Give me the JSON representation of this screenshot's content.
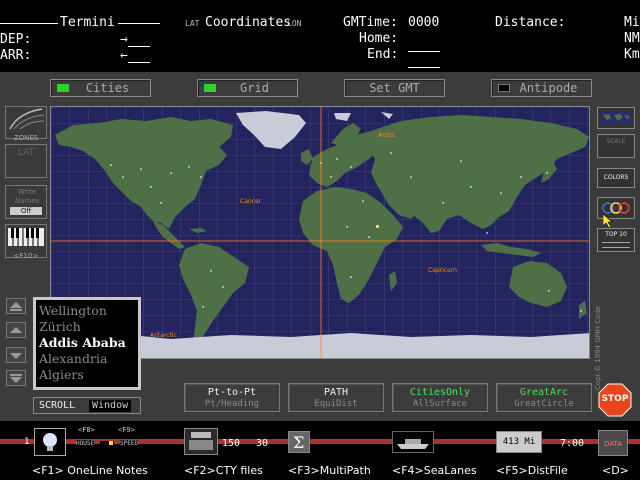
{
  "header": {
    "termini_label": "Termini",
    "dep_label": "DEP:",
    "arr_label": "ARR:",
    "lat_label": "LAT",
    "coordinates_label": "Coordinates",
    "lon_label": "LON",
    "gmtime_label": "GMTime:",
    "gmtime_value": "0000",
    "home_label": "Home:",
    "end_label": "End:",
    "distance_label": "Distance:",
    "unit_mi": "Mi",
    "unit_nm": "NM",
    "unit_km": "Km"
  },
  "toggles": {
    "cities": "Cities",
    "grid": "Grid",
    "set_gmt": "Set GMT",
    "antipode": "Antipode"
  },
  "map": {
    "labels": {
      "arctic": "Arctic",
      "cancer": "Cancer",
      "capricorn": "Capricorn",
      "antarctic": "Antarctic"
    },
    "colors": {
      "ocean": "#23245e",
      "land": "#4f7046",
      "ice": "#c9ccd8",
      "grid": "#5a5c9a",
      "lines": "#ff8a1a"
    }
  },
  "left_tools": {
    "zones": "ZONES",
    "lat": "LAT",
    "write_names": "Write Names",
    "off": "Off",
    "f10": "<F10>"
  },
  "city_list": [
    "Wellington",
    "Zürich",
    "Addis Ababa",
    "Alexandria",
    "Algiers"
  ],
  "city_selected": "Addis Ababa",
  "scroll": {
    "label": "SCROLL",
    "mode": "Window"
  },
  "actions": [
    {
      "line1": "Pt-to-Pt",
      "line2": "Pt/Heading"
    },
    {
      "line1": "PATH",
      "line2": "EquiDist"
    },
    {
      "line1": "CitiesOnly",
      "line2": "AllSurface"
    },
    {
      "line1": "GreatArc",
      "line2": "GreatCircle"
    }
  ],
  "stop": "STOP",
  "right_panel": {
    "scale": "SCALE",
    "colors": "COLORS",
    "top10": "TOP 10",
    "copyright": "Copr.© 1994 GMH Code"
  },
  "bottom": {
    "f8": "<F8>",
    "f9": "<F9>",
    "house": "HOUSE",
    "speed": "SPEED",
    "num_150": "150",
    "num_30": "30",
    "distance_badge": "413 Mi",
    "time": "7:00",
    "data": "DATA",
    "one": "1",
    "fkeys": [
      "<F1> OneLine Notes",
      "<F2>CTY files",
      "<F3>MultiPath",
      "<F4>SeaLanes",
      "<F5>DistFile",
      "<D>"
    ]
  }
}
